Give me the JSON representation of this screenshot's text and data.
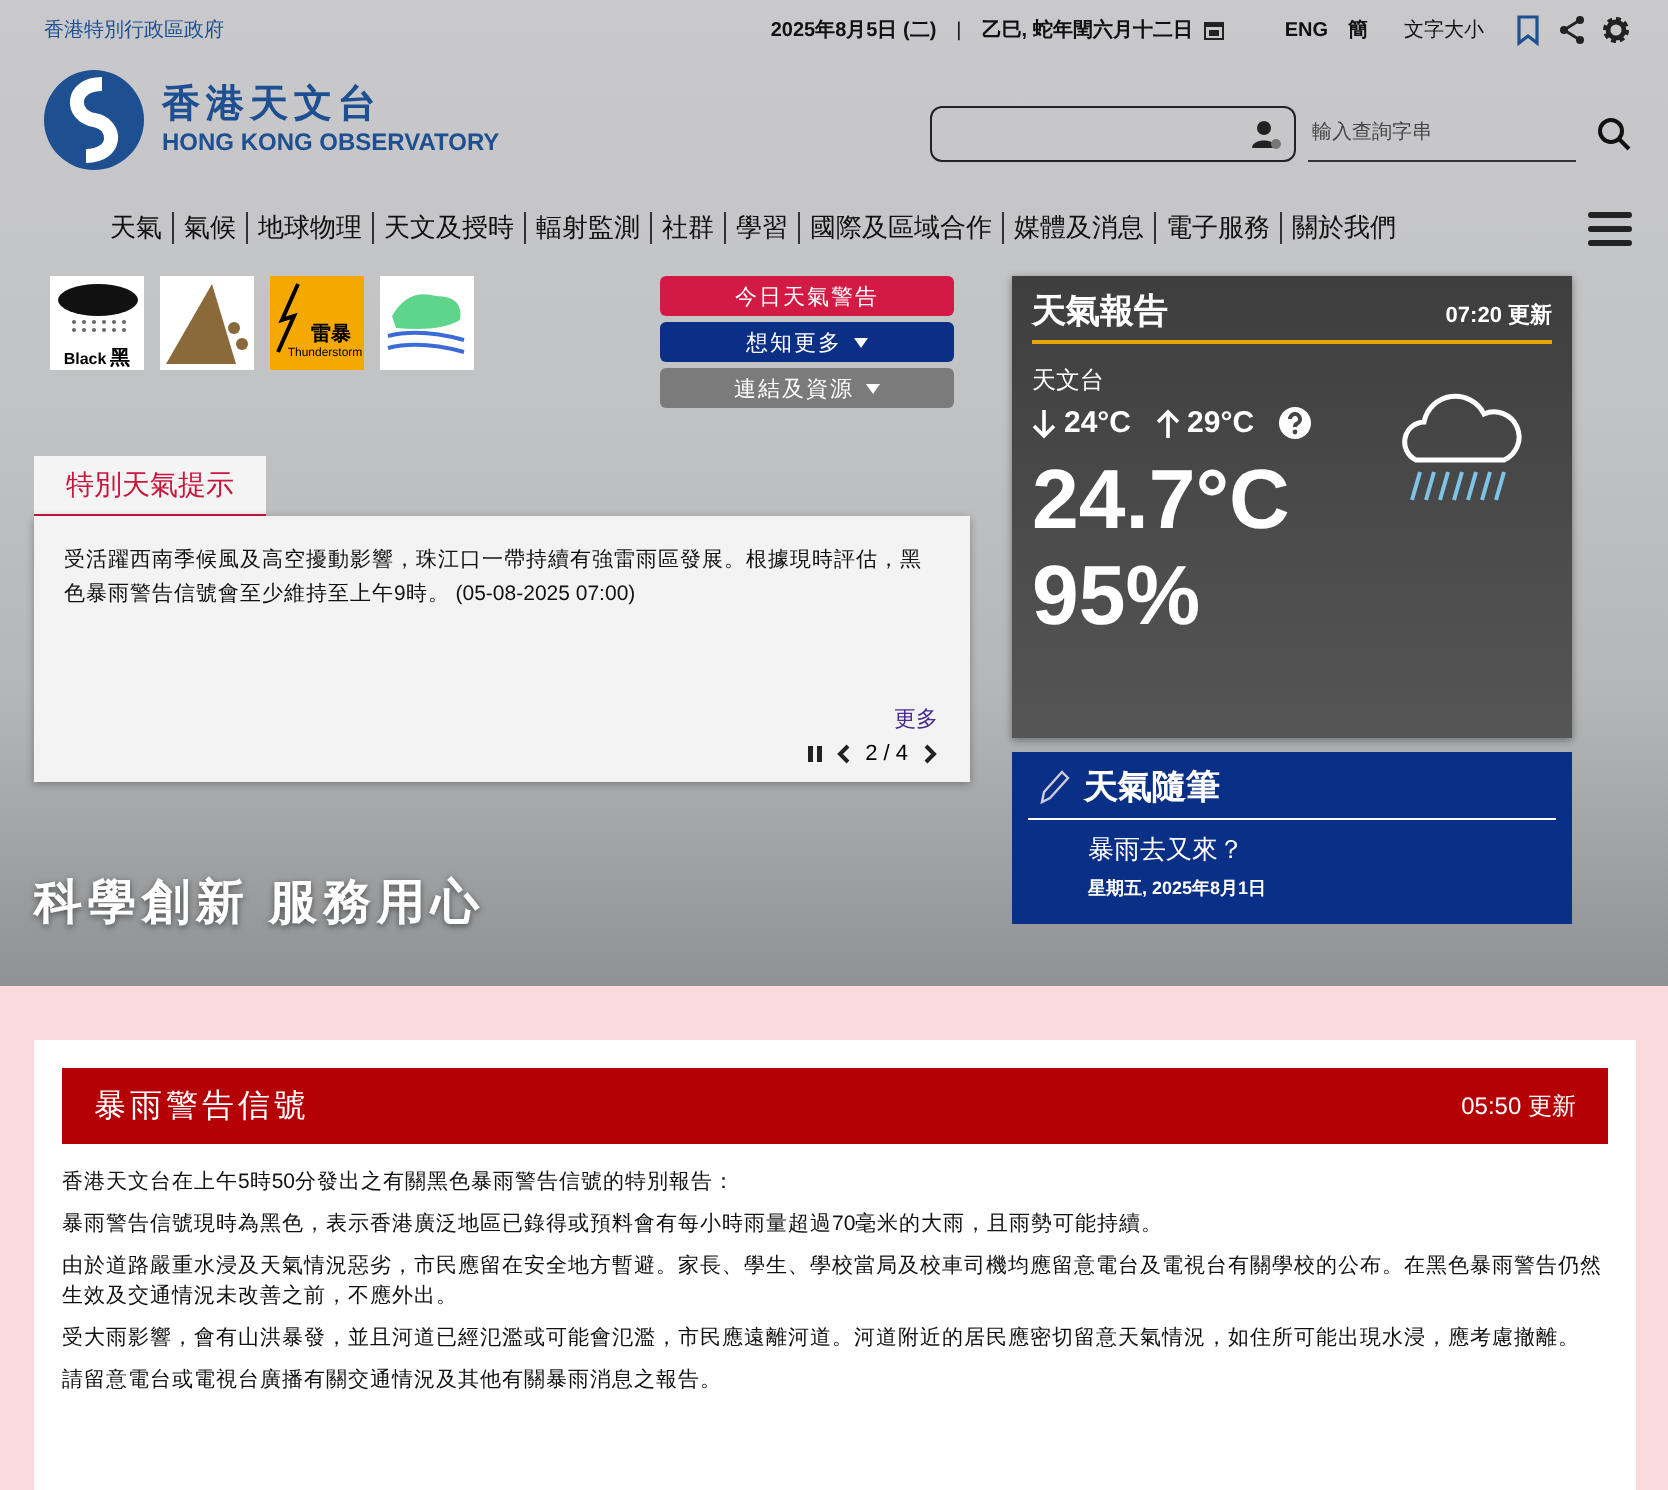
{
  "top_bar": {
    "government": "香港特別行政區政府",
    "date": "2025年8月5日 (二)",
    "separator": "|",
    "lunar_date": "乙巳, 蛇年閏六月十二日",
    "languages": [
      "ENG",
      "簡"
    ],
    "font_size": "文字大小"
  },
  "logo": {
    "title_zh": "香港天文台",
    "title_en": "HONG KONG OBSERVATORY"
  },
  "search": {
    "placeholder": "輸入查詢字串"
  },
  "nav": [
    "天氣",
    "氣候",
    "地球物理",
    "天文及授時",
    "輻射監測",
    "社群",
    "學習",
    "國際及區域合作",
    "媒體及消息",
    "電子服務",
    "關於我們"
  ],
  "warning_icons": [
    {
      "kind": "black_rain",
      "texts": [
        "Black",
        "黑"
      ]
    },
    {
      "kind": "landslip"
    },
    {
      "kind": "thunderstorm",
      "texts": [
        "雷暴",
        "Thunderstorm"
      ]
    },
    {
      "kind": "flood"
    }
  ],
  "buttons": [
    {
      "label": "今日天氣警告",
      "kind": "alert",
      "dropdown": false
    },
    {
      "label": "想知更多",
      "kind": "primary",
      "dropdown": true
    },
    {
      "label": "連結及資源",
      "kind": "secondary",
      "dropdown": true
    }
  ],
  "special_tips": {
    "tab": "特別天氣提示",
    "text": "受活躍西南季候風及高空擾動影響，珠江口一帶持續有強雷雨區發展。根據現時評估，黑色暴雨警告信號會至少維持至上午9時。 (05-08-2025 07:00)",
    "more": "更多",
    "pager": "2 / 4"
  },
  "slogan": "科學創新 服務用心",
  "weather_report": {
    "title": "天氣報告",
    "updated": "07:20 更新",
    "station": "天文台",
    "min": "24°C",
    "max": "29°C",
    "temperature": "24.7°C",
    "humidity": "95%"
  },
  "blog": {
    "title": "天氣隨筆",
    "headline": "暴雨去又來？",
    "date": "星期五, 2025年8月1日"
  },
  "warning_bulletin": {
    "title": "暴雨警告信號",
    "updated": "05:50 更新",
    "paragraphs": [
      "香港天文台在上午5時50分發出之有關黑色暴雨警告信號的特別報告：",
      "暴雨警告信號現時為黑色，表示香港廣泛地區已錄得或預料會有每小時雨量超過70毫米的大雨，且雨勢可能持續。",
      "由於道路嚴重水浸及天氣情況惡劣，市民應留在安全地方暫避。家長、學生、學校當局及校車司機均應留意電台及電視台有關學校的公布。在黑色暴雨警告仍然生效及交通情況未改善之前，不應外出。",
      "受大雨影響，會有山洪暴發，並且河道已經氾濫或可能會氾濫，市民應遠離河道。河道附近的居民應密切留意天氣情況，如住所可能出現水浸，應考慮撤離。",
      "請留意電台或電視台廣播有關交通情況及其他有關暴雨消息之報告。"
    ]
  }
}
